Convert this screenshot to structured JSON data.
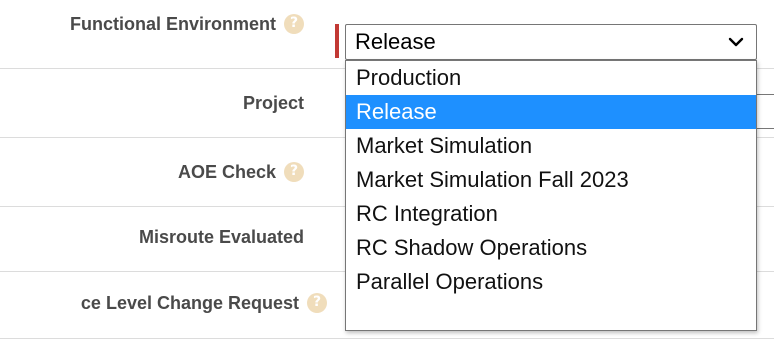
{
  "form": {
    "functional_environment": {
      "label": "Functional Environment",
      "selected": "Release"
    },
    "project": {
      "label": "Project"
    },
    "aoe_check": {
      "label": "AOE Check"
    },
    "misroute_evaluated": {
      "label": "Misroute Evaluated"
    },
    "change_request": {
      "label": "ce Level Change Request"
    }
  },
  "dropdown": {
    "options": [
      {
        "label": "Production",
        "selected": false
      },
      {
        "label": "Release",
        "selected": true
      },
      {
        "label": "Market Simulation",
        "selected": false
      },
      {
        "label": "Market Simulation Fall 2023",
        "selected": false
      },
      {
        "label": "RC Integration",
        "selected": false
      },
      {
        "label": "RC Shadow Operations",
        "selected": false
      },
      {
        "label": "Parallel Operations",
        "selected": false
      }
    ]
  },
  "colors": {
    "highlight": "#1e90ff",
    "required": "#c23934",
    "help_icon": "#f0ddbb"
  }
}
